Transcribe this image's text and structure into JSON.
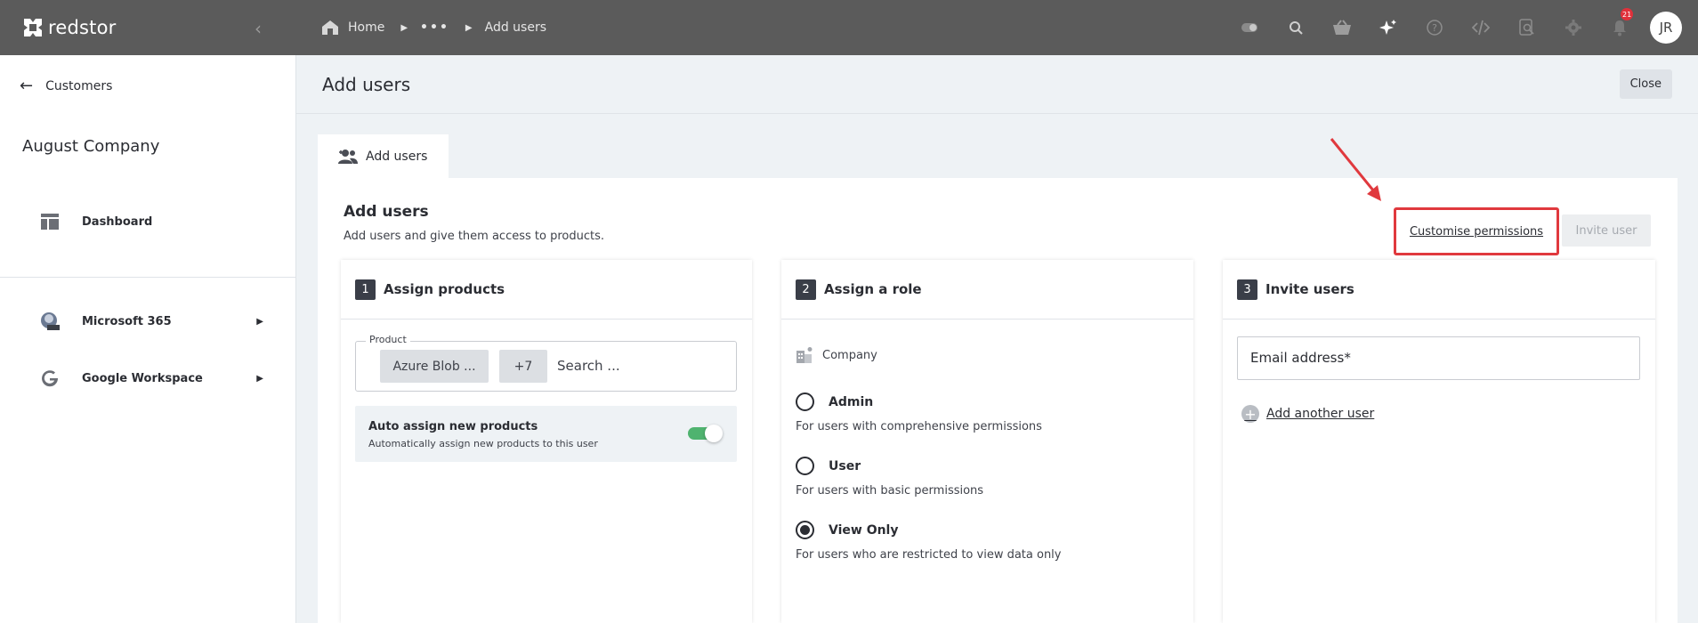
{
  "brand": {
    "name": "redstor"
  },
  "breadcrumb": {
    "home": "Home",
    "ellipsis": "•••",
    "current": "Add users"
  },
  "topbar": {
    "notification_count": "21",
    "avatar_initials": "JR",
    "icons": [
      "toggle-icon",
      "search-icon",
      "basket-icon",
      "sparkle-icon",
      "help-icon",
      "code-icon",
      "search-document-icon",
      "gear-icon",
      "bell-icon"
    ]
  },
  "sidebar": {
    "back_label": "Customers",
    "company": "August Company",
    "dashboard": "Dashboard",
    "products": [
      {
        "label": "Microsoft 365"
      },
      {
        "label": "Google Workspace"
      }
    ]
  },
  "page": {
    "title": "Add users",
    "close": "Close"
  },
  "tab": {
    "label": "Add users"
  },
  "card": {
    "heading": "Add users",
    "subtitle": "Add users and give them access to products.",
    "customise": "Customise permissions",
    "invite": "Invite user"
  },
  "step1": {
    "num": "1",
    "title": "Assign products",
    "product_label": "Product",
    "chip": "Azure Blob ...",
    "more": "+7",
    "search_placeholder": "Search ...",
    "auto_title": "Auto assign new products",
    "auto_desc": "Automatically assign new products to this user",
    "auto_enabled": true
  },
  "step2": {
    "num": "2",
    "title": "Assign a role",
    "scope": "Company",
    "roles": [
      {
        "label": "Admin",
        "desc": "For users with comprehensive permissions",
        "selected": false
      },
      {
        "label": "User",
        "desc": "For users with basic permissions",
        "selected": false
      },
      {
        "label": "View Only",
        "desc": "For users who are restricted to view data only",
        "selected": true
      }
    ]
  },
  "step3": {
    "num": "3",
    "title": "Invite users",
    "email_placeholder": "Email address*",
    "add_another": "Add another user"
  },
  "colors": {
    "topbar": "#5b5b5b",
    "annotation": "#e0393e",
    "toggle": "#4fb36f"
  }
}
